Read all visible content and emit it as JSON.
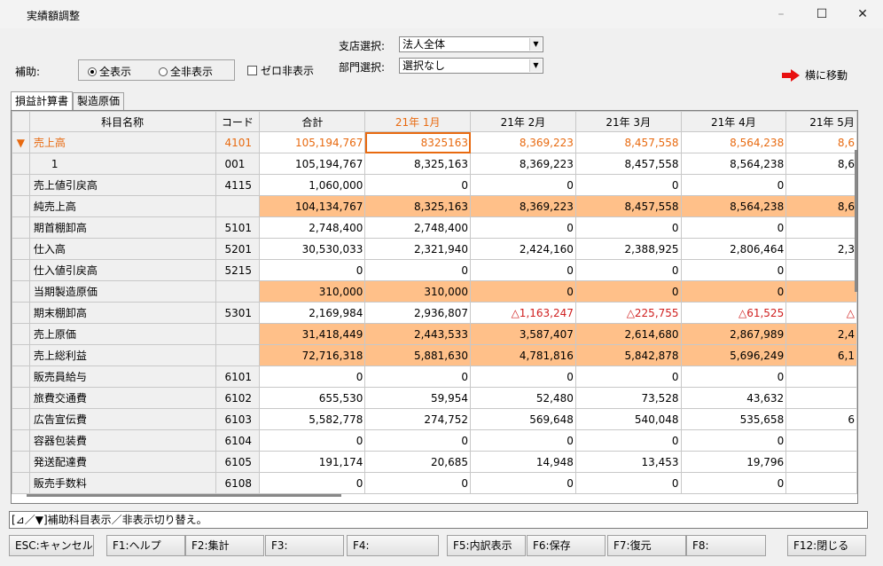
{
  "window": {
    "title": "実績額調整"
  },
  "branch": {
    "label": "支店選択:",
    "value": "法人全体"
  },
  "dept": {
    "label": "部門選択:",
    "value": "選択なし"
  },
  "aux": {
    "label": "補助:",
    "opt_show": "全表示",
    "opt_hide": "全非表示",
    "selected": "全表示"
  },
  "zero_hide": {
    "label": "ゼロ非表示"
  },
  "move_btn": {
    "label": "横に移動"
  },
  "tabs": [
    {
      "label": "損益計算書"
    },
    {
      "label": "製造原価"
    }
  ],
  "table": {
    "headers": [
      "科目名称",
      "コード",
      "合計",
      "21年 1月",
      "21年 2月",
      "21年 3月",
      "21年 4月",
      "21年 5月"
    ],
    "rows": [
      {
        "mark": "▼",
        "name": "売上高",
        "code": "4101",
        "total": "105,194,767",
        "m1": "8325163",
        "m2": "8,369,223",
        "m3": "8,457,558",
        "m4": "8,564,238",
        "m5": "8,6"
      },
      {
        "mark": "",
        "name": "1",
        "code": "001",
        "total": "105,194,767",
        "m1": "8,325,163",
        "m2": "8,369,223",
        "m3": "8,457,558",
        "m4": "8,564,238",
        "m5": "8,6"
      },
      {
        "mark": "",
        "name": "売上値引戻高",
        "code": "4115",
        "total": "1,060,000",
        "m1": "0",
        "m2": "0",
        "m3": "0",
        "m4": "0",
        "m5": ""
      },
      {
        "mark": "",
        "name": "純売上高",
        "code": "",
        "total": "104,134,767",
        "m1": "8,325,163",
        "m2": "8,369,223",
        "m3": "8,457,558",
        "m4": "8,564,238",
        "m5": "8,6"
      },
      {
        "mark": "",
        "name": "期首棚卸高",
        "code": "5101",
        "total": "2,748,400",
        "m1": "2,748,400",
        "m2": "0",
        "m3": "0",
        "m4": "0",
        "m5": ""
      },
      {
        "mark": "",
        "name": "仕入高",
        "code": "5201",
        "total": "30,530,033",
        "m1": "2,321,940",
        "m2": "2,424,160",
        "m3": "2,388,925",
        "m4": "2,806,464",
        "m5": "2,3"
      },
      {
        "mark": "",
        "name": "仕入値引戻高",
        "code": "5215",
        "total": "0",
        "m1": "0",
        "m2": "0",
        "m3": "0",
        "m4": "0",
        "m5": ""
      },
      {
        "mark": "",
        "name": "当期製造原価",
        "code": "",
        "total": "310,000",
        "m1": "310,000",
        "m2": "0",
        "m3": "0",
        "m4": "0",
        "m5": ""
      },
      {
        "mark": "",
        "name": "期末棚卸高",
        "code": "5301",
        "total": "2,169,984",
        "m1": "2,936,807",
        "m2": "△1,163,247",
        "m3": "△225,755",
        "m4": "△61,525",
        "m5": "△"
      },
      {
        "mark": "",
        "name": "売上原価",
        "code": "",
        "total": "31,418,449",
        "m1": "2,443,533",
        "m2": "3,587,407",
        "m3": "2,614,680",
        "m4": "2,867,989",
        "m5": "2,4"
      },
      {
        "mark": "",
        "name": "売上総利益",
        "code": "",
        "total": "72,716,318",
        "m1": "5,881,630",
        "m2": "4,781,816",
        "m3": "5,842,878",
        "m4": "5,696,249",
        "m5": "6,1"
      },
      {
        "mark": "",
        "name": "販売員給与",
        "code": "6101",
        "total": "0",
        "m1": "0",
        "m2": "0",
        "m3": "0",
        "m4": "0",
        "m5": ""
      },
      {
        "mark": "",
        "name": "旅費交通費",
        "code": "6102",
        "total": "655,530",
        "m1": "59,954",
        "m2": "52,480",
        "m3": "73,528",
        "m4": "43,632",
        "m5": ""
      },
      {
        "mark": "",
        "name": "広告宣伝費",
        "code": "6103",
        "total": "5,582,778",
        "m1": "274,752",
        "m2": "569,648",
        "m3": "540,048",
        "m4": "535,658",
        "m5": "6"
      },
      {
        "mark": "",
        "name": "容器包装費",
        "code": "6104",
        "total": "0",
        "m1": "0",
        "m2": "0",
        "m3": "0",
        "m4": "0",
        "m5": ""
      },
      {
        "mark": "",
        "name": "発送配達費",
        "code": "6105",
        "total": "191,174",
        "m1": "20,685",
        "m2": "14,948",
        "m3": "13,453",
        "m4": "19,796",
        "m5": ""
      },
      {
        "mark": "",
        "name": "販売手数料",
        "code": "6108",
        "total": "0",
        "m1": "0",
        "m2": "0",
        "m3": "0",
        "m4": "0",
        "m5": ""
      }
    ]
  },
  "status": {
    "text": "[⊿／▼]補助科目表示／非表示切り替え。"
  },
  "fkeys": [
    "ESC:キャンセル",
    "F1:ヘルプ",
    "F2:集計",
    "F3:",
    "F4:",
    "F5:内訳表示",
    "F6:保存",
    "F7:復元",
    "F8:",
    "F12:閉じる"
  ],
  "colors": {
    "accent": "#e86a10",
    "highlight": "#ffc089",
    "negative": "#d02020"
  }
}
